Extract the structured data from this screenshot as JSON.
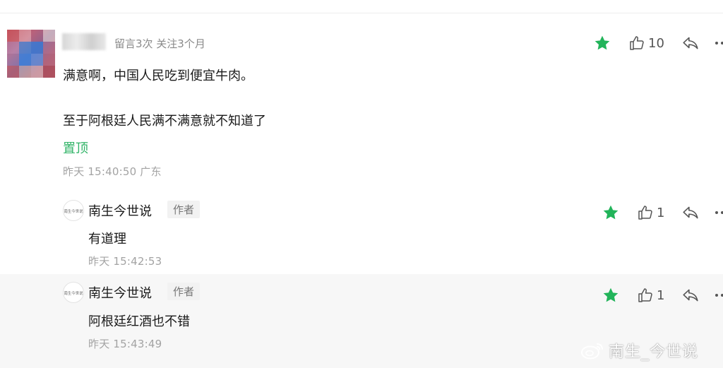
{
  "main_comment": {
    "stats": "留言3次 关注3个月",
    "line1": "满意啊，中国人民吃到便宜牛肉。",
    "line2": "至于阿根廷人民满不满意就不知道了",
    "pin_label": "置顶",
    "timestamp": "昨天 15:40:50 广东",
    "likes": "10"
  },
  "replies": [
    {
      "author": "南生今世说",
      "tag": "作者",
      "text": "有道理",
      "timestamp": "昨天 15:42:53",
      "likes": "1",
      "avatar_text": "南生今世说"
    },
    {
      "author": "南生今世说",
      "tag": "作者",
      "text": "阿根廷红酒也不错",
      "timestamp": "昨天 15:43:49",
      "likes": "1",
      "avatar_text": "南生今世说"
    }
  ],
  "watermark": {
    "text": "南生_今世说"
  },
  "icons": {
    "star": "star-icon",
    "like": "thumbs-up-icon",
    "reply": "reply-icon",
    "more": "more-icon"
  },
  "colors": {
    "accent_green": "#2fb366",
    "star_green": "#22b45a"
  }
}
